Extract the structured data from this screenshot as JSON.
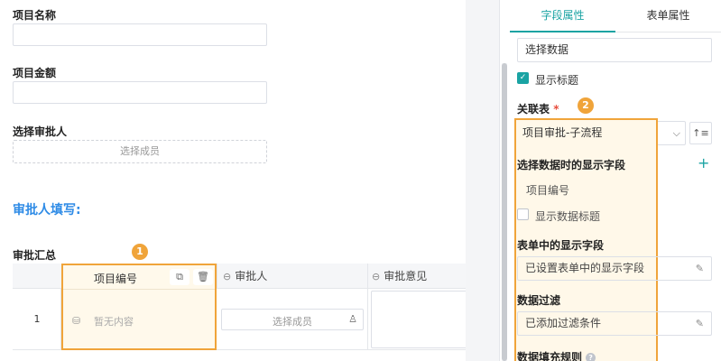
{
  "form": {
    "project_name_label": "项目名称",
    "project_amount_label": "项目金额",
    "approver_label": "选择审批人",
    "approver_placeholder": "选择成员",
    "section_title": "审批人填写:",
    "summary_label": "审批汇总",
    "table": {
      "columns": [
        "项目编号",
        "审批人",
        "审批意见"
      ],
      "row_number": "1",
      "empty_text": "暂无内容",
      "member_placeholder": "选择成员"
    },
    "badge_1": "1"
  },
  "panel": {
    "tabs": [
      "字段属性",
      "表单属性"
    ],
    "active_tab": 0,
    "title_value": "选择数据",
    "show_title_label": "显示标题",
    "relation_label": "关联表",
    "required_mark": "*",
    "badge_2": "2",
    "relation_value": "项目审批-子流程",
    "display_fields_label": "选择数据时的显示字段",
    "display_field_item": "项目编号",
    "show_data_title_label": "显示数据标题",
    "form_display_label": "表单中的显示字段",
    "form_display_value": "已设置表单中的显示字段",
    "filter_label": "数据过滤",
    "filter_value": "已添加过滤条件",
    "fill_rule_label": "数据填充规则"
  },
  "colors": {
    "accent": "#1aa3a3",
    "highlight": "#f0a43a",
    "section_blue": "#2e8be6"
  }
}
